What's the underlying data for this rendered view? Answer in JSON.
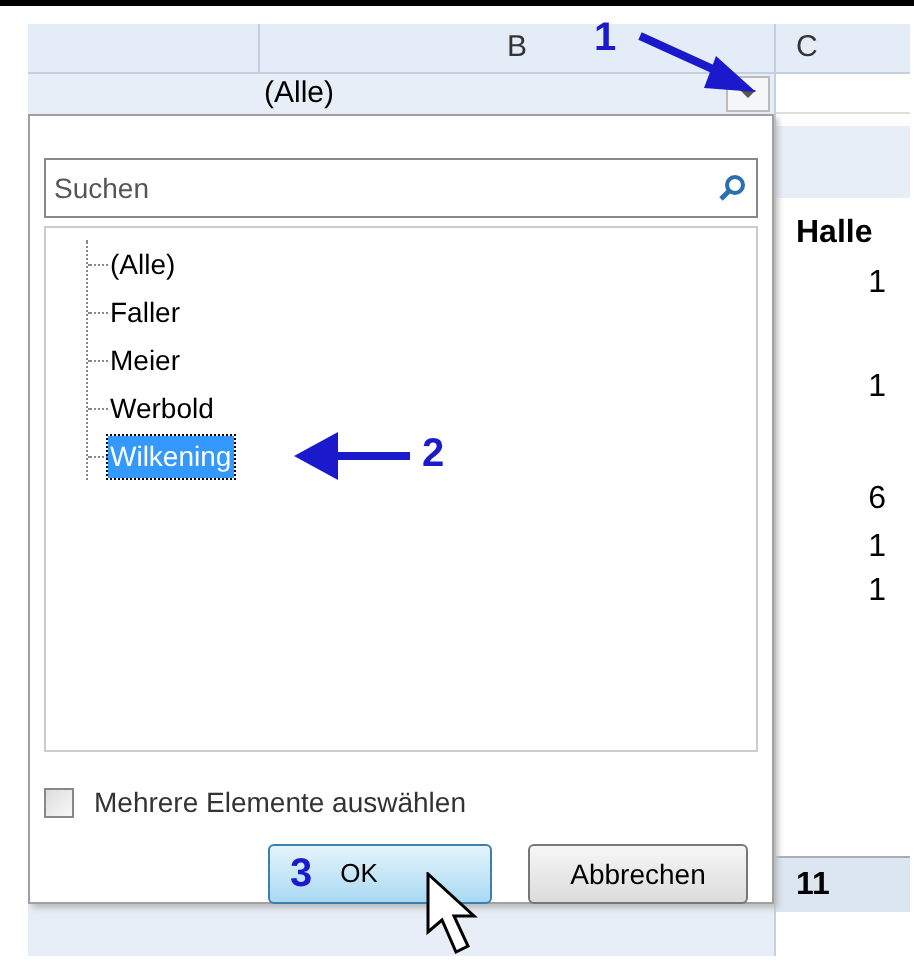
{
  "columns": [
    "B",
    "C"
  ],
  "filter_cell": {
    "value": "(Alle)"
  },
  "dropdown": {
    "search": {
      "placeholder": "Suchen"
    },
    "items": [
      {
        "label": "(Alle)",
        "selected": false
      },
      {
        "label": "Faller",
        "selected": false
      },
      {
        "label": "Meier",
        "selected": false
      },
      {
        "label": "Werbold",
        "selected": false
      },
      {
        "label": "Wilkening",
        "selected": true
      }
    ],
    "multi_select": {
      "label": "Mehrere Elemente auswählen",
      "checked": false
    },
    "buttons": [
      "OK",
      "Abbrechen"
    ]
  },
  "column_c": {
    "header": "Halle",
    "values": [
      "1",
      "1",
      "6",
      "1",
      "1"
    ],
    "total": "11"
  },
  "annotations": [
    "1",
    "2",
    "3"
  ]
}
